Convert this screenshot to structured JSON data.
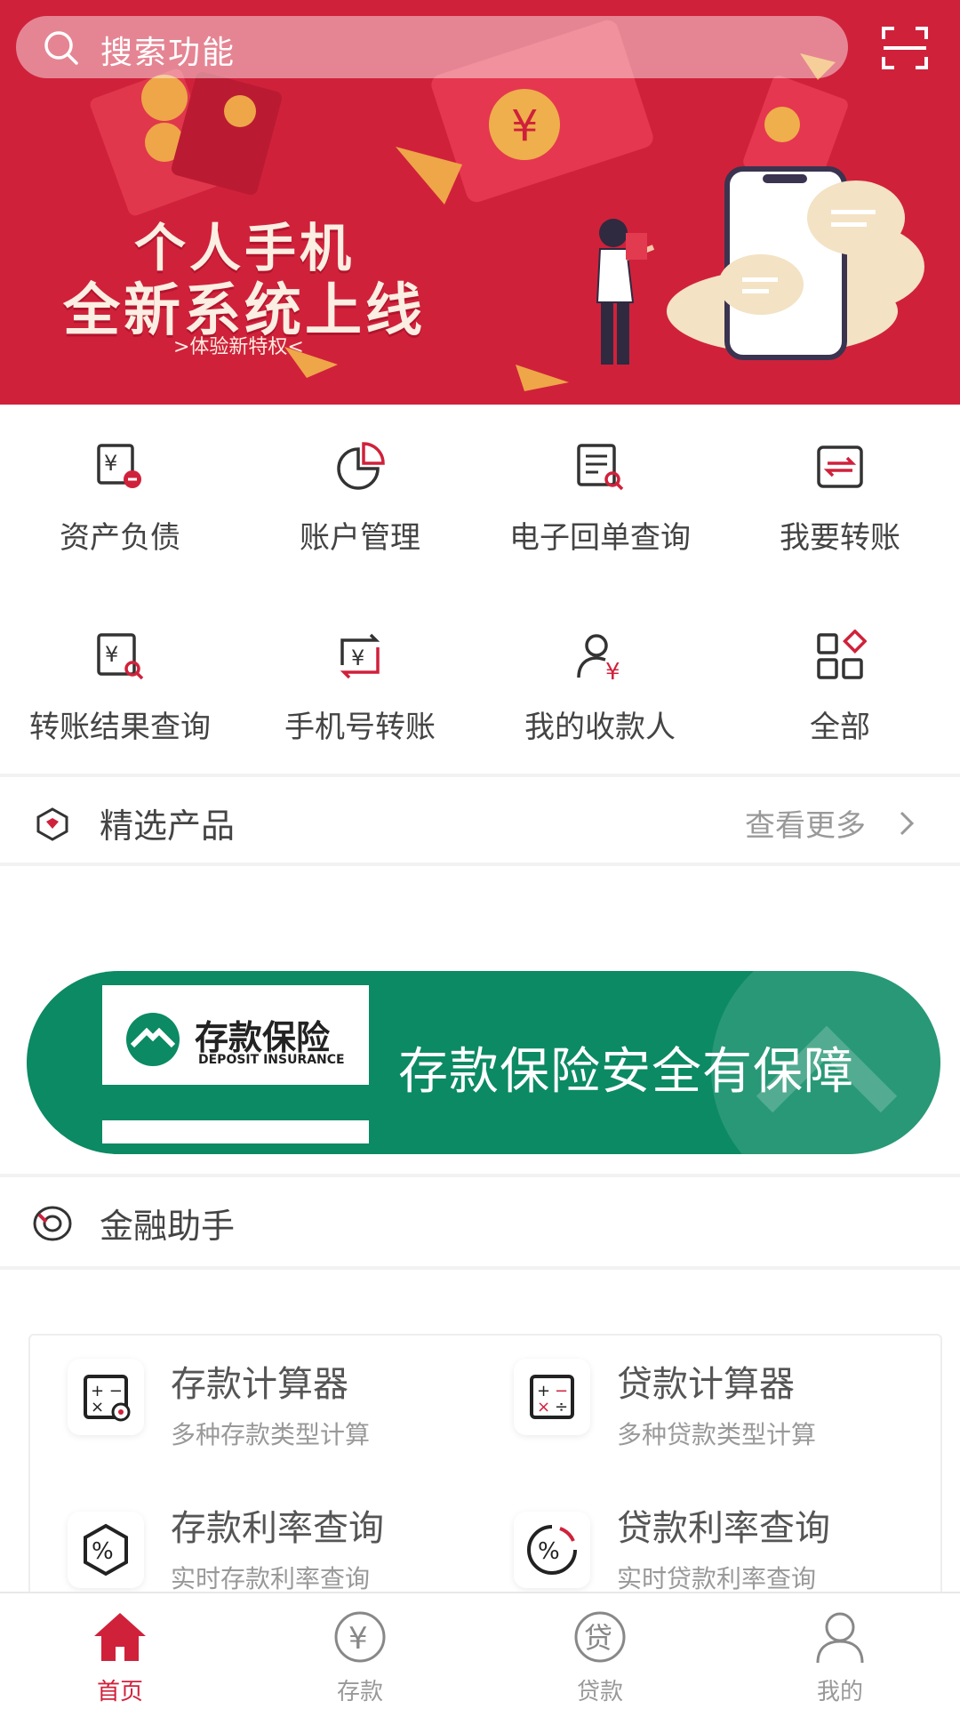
{
  "banner": {
    "search_placeholder": "搜索功能",
    "headline_1": "个人手机",
    "headline_2": "全新系统上线",
    "cta": ">体验新特权<"
  },
  "quick_actions": [
    {
      "label": "资产负债",
      "icon": "asset-liability-icon"
    },
    {
      "label": "账户管理",
      "icon": "pie-chart-icon"
    },
    {
      "label": "电子回单查询",
      "icon": "receipt-search-icon"
    },
    {
      "label": "我要转账",
      "icon": "transfer-icon"
    },
    {
      "label": "转账结果查询",
      "icon": "transfer-result-search-icon"
    },
    {
      "label": "手机号转账",
      "icon": "phone-transfer-icon"
    },
    {
      "label": "我的收款人",
      "icon": "payee-icon"
    },
    {
      "label": "全部",
      "icon": "all-apps-icon"
    }
  ],
  "featured": {
    "title": "精选产品",
    "more": "查看更多"
  },
  "deposit_banner": {
    "card_title": "存款保险",
    "card_subtitle": "DEPOSIT INSURANCE",
    "slogan": "存款保险安全有保障"
  },
  "finance_assistant": {
    "title": "金融助手",
    "tools": [
      {
        "title": "存款计算器",
        "subtitle": "多种存款类型计算"
      },
      {
        "title": "贷款计算器",
        "subtitle": "多种贷款类型计算"
      },
      {
        "title": "存款利率查询",
        "subtitle": "实时存款利率查询"
      },
      {
        "title": "贷款利率查询",
        "subtitle": "实时贷款利率查询"
      }
    ]
  },
  "tabs": [
    {
      "label": "首页",
      "active": true
    },
    {
      "label": "存款",
      "active": false
    },
    {
      "label": "贷款",
      "active": false
    },
    {
      "label": "我的",
      "active": false
    }
  ],
  "colors": {
    "brand_red": "#d0213b",
    "deposit_green": "#0b8a63",
    "text_muted": "#999999"
  }
}
